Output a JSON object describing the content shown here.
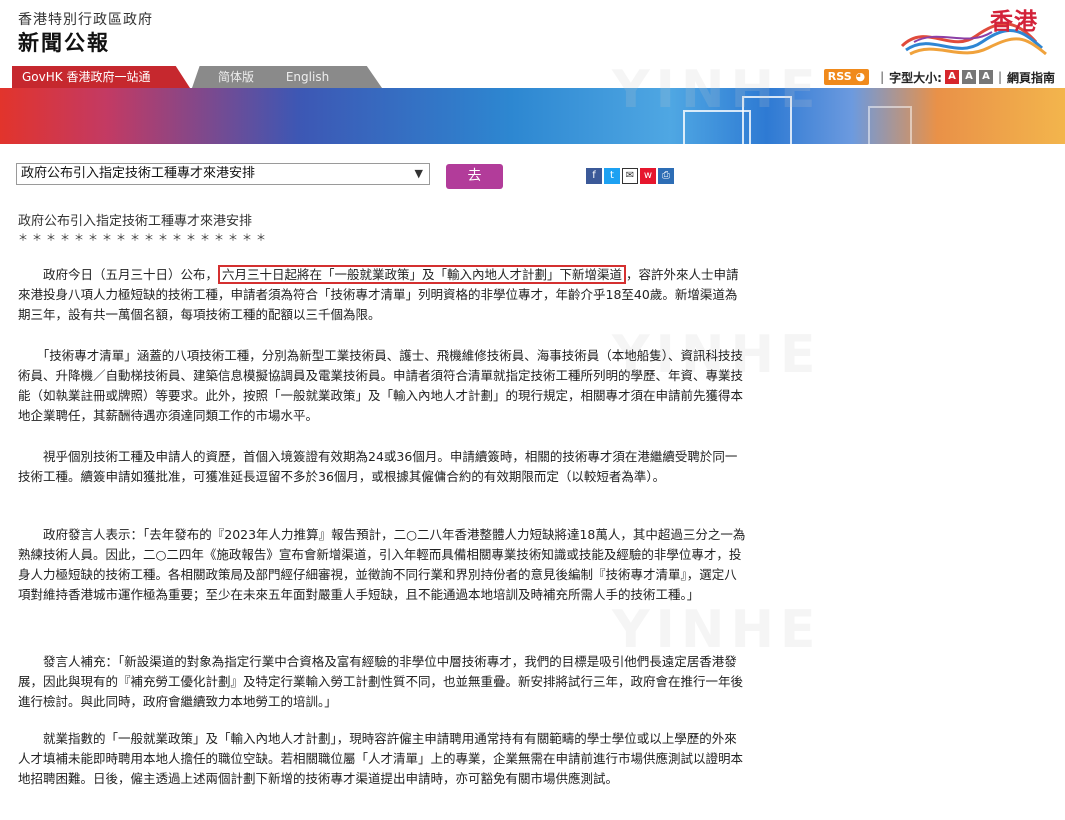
{
  "header": {
    "org": "香港特別行政區政府",
    "title": "新聞公報",
    "logo_text": "香港"
  },
  "nav": {
    "govhk": "GovHK 香港政府一站通",
    "simplified": "简体版",
    "english": "English",
    "rss": "RSS",
    "font_size_label": "字型大小:",
    "font_sizes": [
      "A",
      "A",
      "A"
    ],
    "site_guide": "網頁指南"
  },
  "toolbar": {
    "select_value": "政府公布引入指定技術工種專才來港安排",
    "go_label": "去",
    "share_icons": [
      "facebook-icon",
      "twitter-icon",
      "email-icon",
      "weibo-icon",
      "print-icon"
    ]
  },
  "article": {
    "title": "政府公布引入指定技術工種專才來港安排",
    "stars": "＊＊＊＊＊＊＊＊＊＊＊＊＊＊＊＊＊＊",
    "p1_pre": "　　政府今日（五月三十日）公布，",
    "p1_highlight": "六月三十日起將在「一般就業政策」及「輸入內地人才計劃」下新增渠道",
    "p1_post": "，容許外來人士申請來港投身八項人力極短缺的技術工種，申請者須為符合「技術專才清單」列明資格的非學位專才，年齡介乎18至40歲。新增渠道為期三年，設有共一萬個名額，每項技術工種的配額以三千個為限。",
    "p2": "　　「技術專才清單」涵蓋的八項技術工種，分別為新型工業技術員、護士、飛機維修技術員、海事技術員（本地船隻）、資訊科技技術員、升降機／自動梯技術員、建築信息模擬協調員及電業技術員。申請者須符合清單就指定技術工種所列明的學歷、年資、專業技能（如執業註冊或牌照）等要求。此外，按照「一般就業政策」及「輸入內地人才計劃」的現行規定，相關專才須在申請前先獲得本地企業聘任，其薪酬待遇亦須達同類工作的市場水平。",
    "p3": "　　視乎個別技術工種及申請人的資歷，首個入境簽證有效期為24或36個月。申請續簽時，相關的技術專才須在港繼續受聘於同一技術工種。續簽申請如獲批准，可獲准延長逗留不多於36個月，或根據其僱傭合約的有效期限而定（以較短者為準）。",
    "p4": "　　政府發言人表示：「去年發布的『2023年人力推算』報告預計，二○二八年香港整體人力短缺將達18萬人，其中超過三分之一為熟練技術人員。因此，二○二四年《施政報告》宣布會新增渠道，引入年輕而具備相關專業技術知識或技能及經驗的非學位專才，投身人力極短缺的技術工種。各相關政策局及部門經仔細審視，並徵詢不同行業和界別持份者的意見後編制『技術專才清單』，選定八項對維持香港城市運作極為重要；至少在未來五年面對嚴重人手短缺，且不能通過本地培訓及時補充所需人手的技術工種。」",
    "p5": "　　發言人補充：「新設渠道的對象為指定行業中合資格及富有經驗的非學位中層技術專才，我們的目標是吸引他們長遠定居香港發展，因此與現有的『補充勞工優化計劃』及特定行業輸入勞工計劃性質不同，也並無重疊。新安排將試行三年，政府會在推行一年後進行檢討。與此同時，政府會繼續致力本地勞工的培訓。」",
    "p6": "　　就業指數的「一般就業政策」及「輸入內地人才計劃」，現時容許僱主申請聘用通常持有有關範疇的學士學位或以上學歷的外來人才填補未能即時聘用本地人擔任的職位空缺。若相關職位屬「人才清單」上的專業，企業無需在申請前進行市場供應測試以證明本地招聘困難。日後，僱主透過上述兩個計劃下新增的技術專才渠道提出申請時，亦可豁免有關市場供應測試。"
  }
}
